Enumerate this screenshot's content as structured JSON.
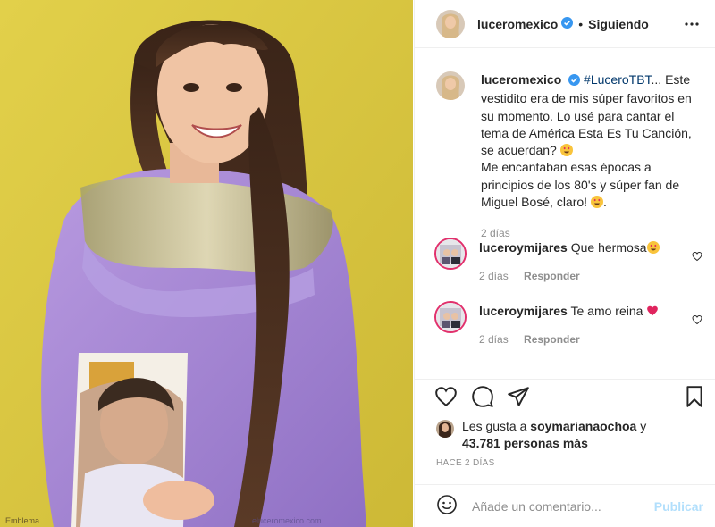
{
  "post": {
    "username": "luceromexico",
    "separator": "•",
    "follow_status": "Siguiendo",
    "caption": {
      "hashtag": "#LuceroTBT",
      "text_1": "... Este vestidito era de mis súper favoritos en su momento. Lo usé para cantar el tema de América Esta Es Tu Canción, se acuerdan?",
      "text_2": "Me encantaban esas épocas a principios de los 80's y súper fan de Miguel Bosé, claro!",
      "text_3": ".",
      "time": "2 días"
    },
    "comments": [
      {
        "username": "luceroymijares",
        "text": "Que hermosa",
        "time": "2 días",
        "reply_label": "Responder"
      },
      {
        "username": "luceroymijares",
        "text": "Te amo reina",
        "time": "2 días",
        "reply_label": "Responder"
      }
    ],
    "likes": {
      "prefix": "Les gusta a",
      "user": "soymarianaochoa",
      "connector": "y",
      "count_text": "43.781 personas más"
    },
    "posted_ago": "HACE 2 DÍAS",
    "add_comment": {
      "placeholder": "Añade un comentario...",
      "publish_label": "Publicar"
    }
  },
  "photo": {
    "watermark_left": "Emblema",
    "watermark_right": "eluceromexico.com"
  },
  "icons": {
    "verified": "verified-badge-icon",
    "more": "more-options-icon",
    "like": "heart-icon",
    "comment": "comment-icon",
    "share": "share-icon",
    "save": "bookmark-icon",
    "emoji": "smiley-icon"
  },
  "colors": {
    "photo_bg": "#d9c83f",
    "dress": "#a98ad6",
    "verified": "#3897f0",
    "hashtag": "#00376b",
    "publish": "#b2dffc",
    "heart_red": "#e0245e"
  }
}
